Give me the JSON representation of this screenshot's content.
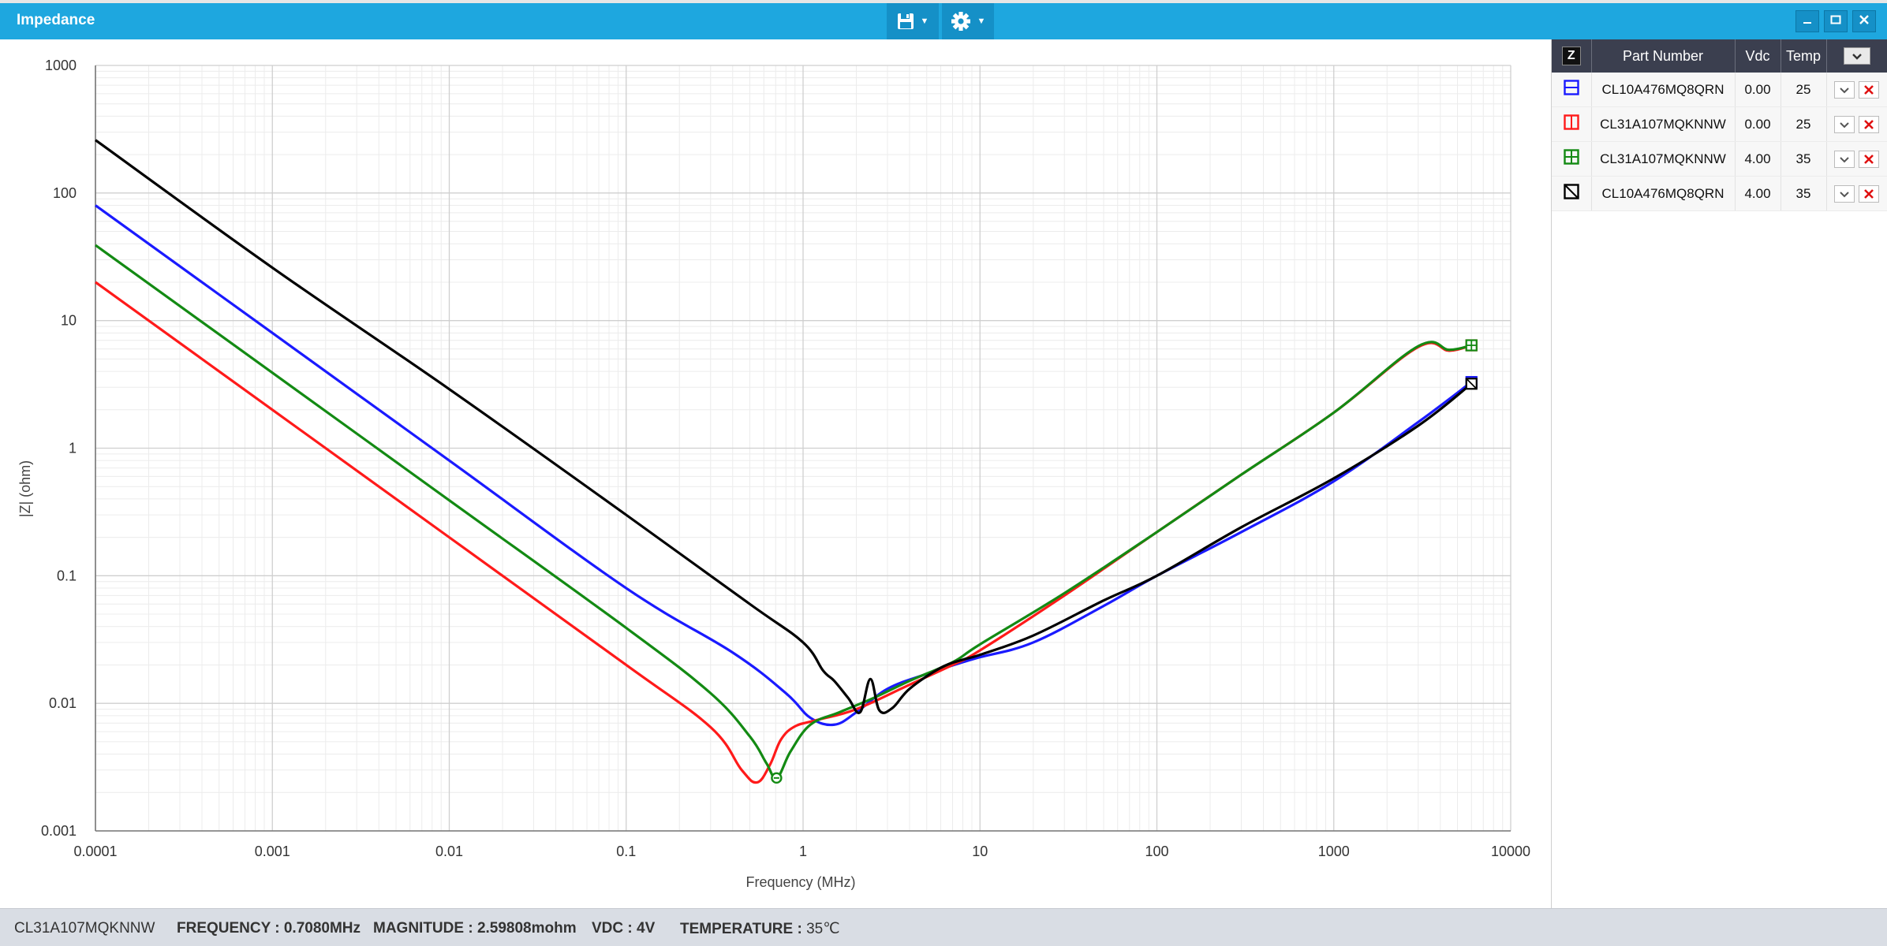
{
  "window": {
    "title": "Impedance"
  },
  "toolbar": {
    "save_icon": "floppy-disk-icon",
    "settings_icon": "gear-icon"
  },
  "window_controls": [
    "minimize-icon",
    "restore-icon",
    "close-icon"
  ],
  "panel": {
    "z_label": "Z",
    "headers": {
      "part": "Part Number",
      "vdc": "Vdc",
      "temp": "Temp"
    },
    "rows": [
      {
        "color": "#1a1aff",
        "marker": "square-h",
        "part": "CL10A476MQ8QRN",
        "vdc": "0.00",
        "temp": "25"
      },
      {
        "color": "#ff1a1a",
        "marker": "square-v",
        "part": "CL31A107MQKNNW",
        "vdc": "0.00",
        "temp": "25"
      },
      {
        "color": "#138a13",
        "marker": "square-cross",
        "part": "CL31A107MQKNNW",
        "vdc": "4.00",
        "temp": "35"
      },
      {
        "color": "#000000",
        "marker": "square-diag",
        "part": "CL10A476MQ8QRN",
        "vdc": "4.00",
        "temp": "35"
      }
    ]
  },
  "status": {
    "part": "CL31A107MQKNNW",
    "frequency_label": "FREQUENCY : ",
    "frequency": "0.7080MHz",
    "magnitude_label": "MAGNITUDE : ",
    "magnitude": "2.59808mohm",
    "vdc_label": "VDC : ",
    "vdc": "4V",
    "temperature_label": "TEMPERATURE : ",
    "temperature": "35℃"
  },
  "chart_data": {
    "type": "line",
    "xlabel": "Frequency (MHz)",
    "ylabel": "|Z| (ohm)",
    "x_scale": "log",
    "y_scale": "log",
    "xlim": [
      0.0001,
      10000
    ],
    "ylim": [
      0.001,
      1000
    ],
    "x_ticks": [
      "0.0001",
      "0.001",
      "0.01",
      "0.1",
      "1",
      "10",
      "100",
      "1000",
      "10000"
    ],
    "y_ticks": [
      "1000",
      "100",
      "10",
      "1",
      "0.1",
      "0.01",
      "0.001"
    ],
    "grid": true,
    "series": [
      {
        "color": "#1a1aff",
        "x": [
          0.0001,
          0.001,
          0.01,
          0.1,
          0.4,
          0.8,
          1.1,
          1.5,
          2.0,
          3,
          5,
          8,
          10,
          20,
          50,
          100,
          300,
          1000,
          3000,
          6000
        ],
        "y": [
          80,
          8,
          0.8,
          0.08,
          0.025,
          0.012,
          0.0077,
          0.0068,
          0.0085,
          0.013,
          0.017,
          0.021,
          0.023,
          0.03,
          0.058,
          0.1,
          0.22,
          0.55,
          1.6,
          3.3
        ]
      },
      {
        "color": "#ff1a1a",
        "x": [
          0.0001,
          0.001,
          0.01,
          0.1,
          0.3,
          0.45,
          0.55,
          0.65,
          0.75,
          0.9,
          1.2,
          2,
          4,
          7,
          10,
          30,
          100,
          300,
          1000,
          3000,
          4500,
          6000
        ],
        "y": [
          20,
          2,
          0.2,
          0.02,
          0.0065,
          0.003,
          0.0024,
          0.0033,
          0.0052,
          0.0066,
          0.0074,
          0.009,
          0.014,
          0.02,
          0.026,
          0.07,
          0.22,
          0.62,
          1.9,
          6.2,
          5.8,
          6.4
        ]
      },
      {
        "color": "#138a13",
        "x": [
          0.0001,
          0.001,
          0.01,
          0.1,
          0.3,
          0.5,
          0.62,
          0.71,
          0.85,
          1.1,
          1.6,
          2.5,
          4,
          7,
          10,
          30,
          100,
          300,
          1000,
          3000,
          4500,
          6000
        ],
        "y": [
          39,
          3.9,
          0.39,
          0.039,
          0.012,
          0.0055,
          0.0034,
          0.0026,
          0.0042,
          0.0068,
          0.0085,
          0.011,
          0.015,
          0.021,
          0.029,
          0.073,
          0.22,
          0.62,
          1.9,
          6.3,
          5.9,
          6.4
        ]
      },
      {
        "color": "#000000",
        "x": [
          0.0001,
          0.001,
          0.01,
          0.1,
          0.5,
          1,
          1.3,
          1.5,
          1.8,
          2.1,
          2.4,
          2.7,
          3.2,
          4,
          6,
          8,
          10,
          20,
          50,
          100,
          300,
          1000,
          3000,
          6000
        ],
        "y": [
          260,
          26,
          2.9,
          0.3,
          0.06,
          0.03,
          0.018,
          0.015,
          0.011,
          0.0085,
          0.0155,
          0.0088,
          0.0092,
          0.013,
          0.019,
          0.022,
          0.024,
          0.034,
          0.064,
          0.1,
          0.24,
          0.58,
          1.5,
          3.2
        ]
      }
    ],
    "markers": [
      {
        "series": 0,
        "x": 6000,
        "y": 3.3,
        "shape": "square-h"
      },
      {
        "series": 1,
        "x": 6000,
        "y": 6.4,
        "shape": "square-v"
      },
      {
        "series": 2,
        "x": 6000,
        "y": 6.4,
        "shape": "square-cross"
      },
      {
        "series": 3,
        "x": 6000,
        "y": 3.2,
        "shape": "square-diag"
      },
      {
        "series": 2,
        "x": 0.708,
        "y": 0.0026,
        "shape": "circle-minus"
      }
    ]
  }
}
